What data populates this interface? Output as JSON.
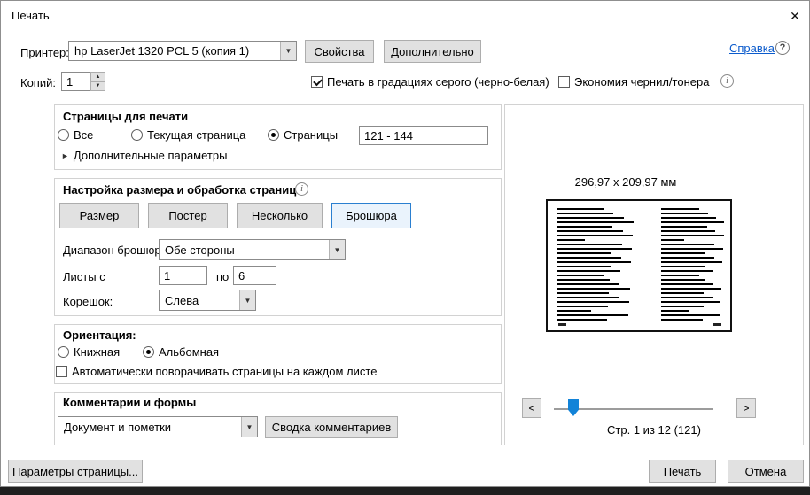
{
  "window": {
    "title": "Печать"
  },
  "icons": {
    "close": "✕",
    "dropdown": "▼",
    "spin_up": "▲",
    "spin_down": "▼",
    "disclosure": "►",
    "info": "i",
    "help": "?"
  },
  "toolbar": {
    "printer_label": "Принтер:",
    "printer_value": "hp LaserJet 1320 PCL 5 (копия 1)",
    "properties": "Свойства",
    "advanced": "Дополнительно",
    "help": "Справка",
    "copies_label": "Копий:",
    "copies_value": "1",
    "grayscale": "Печать в градациях серого (черно-белая)",
    "economy": "Экономия чернил/тонера"
  },
  "pages": {
    "title": "Страницы для печати",
    "all": "Все",
    "current": "Текущая страница",
    "range": "Страницы",
    "range_value": "121 - 144",
    "more": "Дополнительные параметры"
  },
  "sizing": {
    "title": "Настройка размера и обработка страниц",
    "size": "Размер",
    "poster": "Постер",
    "multiple": "Несколько",
    "booklet": "Брошюра",
    "subset_label": "Диапазон брошюры:",
    "subset_value": "Обе стороны",
    "sheets_label": "Листы с",
    "sheets_from": "1",
    "to_label": "по",
    "sheets_to": "6",
    "binding_label": "Корешок:",
    "binding_value": "Слева"
  },
  "orientation": {
    "title": "Ориентация:",
    "portrait": "Книжная",
    "landscape": "Альбомная",
    "autorotate": "Автоматически поворачивать страницы на каждом листе"
  },
  "comments": {
    "title": "Комментарии и формы",
    "value": "Документ и пометки",
    "summary": "Сводка комментариев"
  },
  "preview": {
    "dimensions": "296,97 x 209,97 мм",
    "prev": "<",
    "next": ">",
    "page_info": "Стр. 1 из 12 (121)"
  },
  "footer": {
    "page_setup": "Параметры страницы...",
    "print": "Печать",
    "cancel": "Отмена"
  },
  "colors": {
    "accent": "#1283d8",
    "selected_border": "#2a7fd0",
    "link": "#0b5bcc"
  }
}
